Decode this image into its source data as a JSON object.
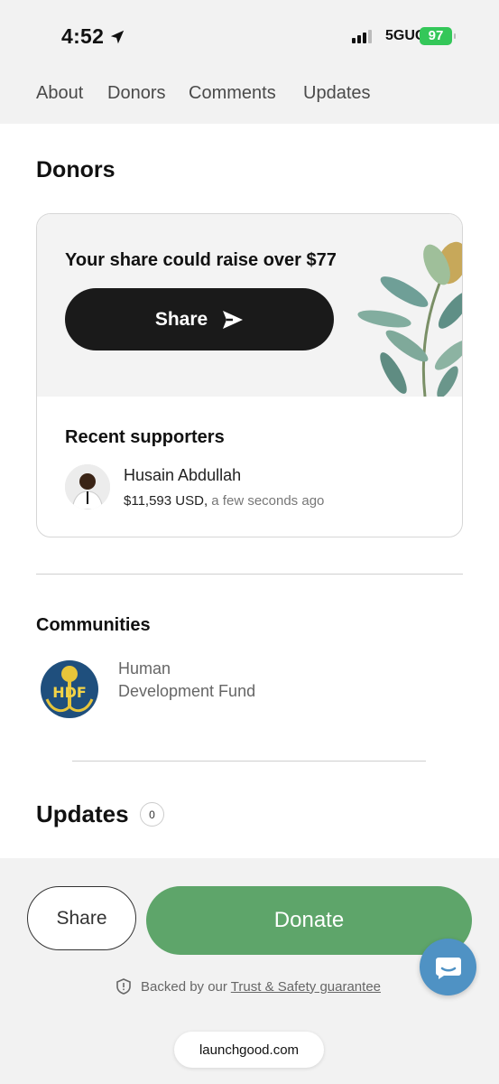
{
  "status_bar": {
    "time": "4:52",
    "network": "5GUC",
    "battery": "97"
  },
  "tabs": [
    "About",
    "Donors",
    "Comments",
    "Updates"
  ],
  "donors_section": {
    "title": "Donors",
    "share_hint": "Your share could raise over $77",
    "share_button": "Share",
    "recent_title": "Recent supporters",
    "supporter": {
      "name": "Husain Abdullah",
      "amount": "$11,593 USD,",
      "time": "a few seconds ago"
    }
  },
  "communities": {
    "title": "Communities",
    "line1": "Human",
    "line2": "Development Fund",
    "logo_letters": "HDF"
  },
  "updates": {
    "title": "Updates",
    "count": "0"
  },
  "bottom_bar": {
    "share_label": "Share",
    "donate_label": "Donate",
    "trust_prefix": "Backed by our",
    "trust_link": "Trust & Safety guarantee",
    "url": "launchgood.com"
  },
  "colors": {
    "donate_green": "#5ea56a",
    "chat_blue": "#4f92c4",
    "share_black": "#1a1a1a"
  }
}
